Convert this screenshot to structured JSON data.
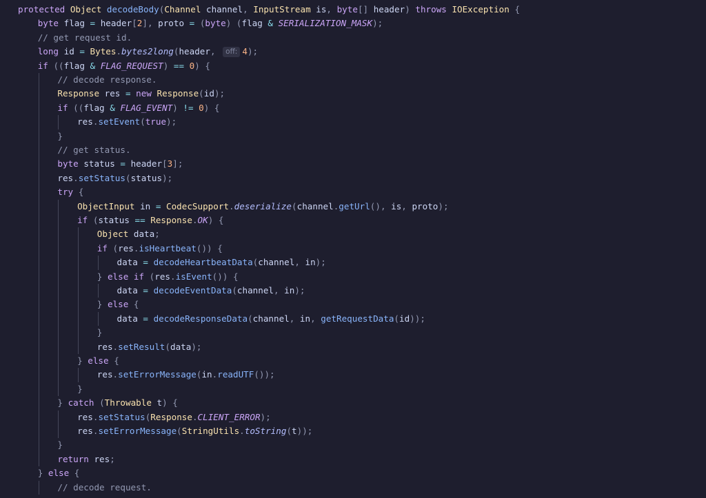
{
  "code": {
    "lines": [
      [
        [
          "kw",
          "protected "
        ],
        [
          "ty",
          "Object "
        ],
        [
          "fn",
          "decodeBody"
        ],
        [
          "pu",
          "("
        ],
        [
          "ty",
          "Channel "
        ],
        [
          "va",
          "channel"
        ],
        [
          "pu",
          ", "
        ],
        [
          "ty",
          "InputStream "
        ],
        [
          "va",
          "is"
        ],
        [
          "pu",
          ", "
        ],
        [
          "kw",
          "byte"
        ],
        [
          "pu",
          "[] "
        ],
        [
          "va",
          "header"
        ],
        [
          "pu",
          ") "
        ],
        [
          "kw",
          "throws "
        ],
        [
          "ty",
          "IOException "
        ],
        [
          "pu",
          "{"
        ]
      ],
      [
        [
          "kw",
          "byte "
        ],
        [
          "va",
          "flag "
        ],
        [
          "op",
          "= "
        ],
        [
          "va",
          "header"
        ],
        [
          "pu",
          "["
        ],
        [
          "nu",
          "2"
        ],
        [
          "pu",
          "], "
        ],
        [
          "va",
          "proto "
        ],
        [
          "op",
          "= "
        ],
        [
          "pu",
          "("
        ],
        [
          "kw",
          "byte"
        ],
        [
          "pu",
          ") ("
        ],
        [
          "va",
          "flag "
        ],
        [
          "op",
          "& "
        ],
        [
          "co",
          "SERIALIZATION_MASK"
        ],
        [
          "pu",
          ");"
        ]
      ],
      [
        [
          "cm",
          "// get request id."
        ]
      ],
      [
        [
          "kw",
          "long "
        ],
        [
          "va",
          "id "
        ],
        [
          "op",
          "= "
        ],
        [
          "ty",
          "Bytes"
        ],
        [
          "pu",
          "."
        ],
        [
          "it",
          "bytes2long"
        ],
        [
          "pu",
          "("
        ],
        [
          "va",
          "header"
        ],
        [
          "pu",
          ", "
        ],
        [
          "hint",
          "off:"
        ],
        [
          "nu",
          "4"
        ],
        [
          "pu",
          ");"
        ]
      ],
      [
        [
          "kw",
          "if "
        ],
        [
          "pu",
          "(("
        ],
        [
          "va",
          "flag "
        ],
        [
          "op",
          "& "
        ],
        [
          "co",
          "FLAG_REQUEST"
        ],
        [
          "pu",
          ") "
        ],
        [
          "op",
          "== "
        ],
        [
          "nu",
          "0"
        ],
        [
          "pu",
          ") {"
        ]
      ],
      [
        [
          "cm",
          "// decode response."
        ]
      ],
      [
        [
          "ty",
          "Response "
        ],
        [
          "va",
          "res "
        ],
        [
          "op",
          "= "
        ],
        [
          "kw",
          "new "
        ],
        [
          "ty",
          "Response"
        ],
        [
          "pu",
          "("
        ],
        [
          "va",
          "id"
        ],
        [
          "pu",
          ");"
        ]
      ],
      [
        [
          "kw",
          "if "
        ],
        [
          "pu",
          "(("
        ],
        [
          "va",
          "flag "
        ],
        [
          "op",
          "& "
        ],
        [
          "co",
          "FLAG_EVENT"
        ],
        [
          "pu",
          ") "
        ],
        [
          "op",
          "!= "
        ],
        [
          "nu",
          "0"
        ],
        [
          "pu",
          ") {"
        ]
      ],
      [
        [
          "va",
          "res"
        ],
        [
          "pu",
          "."
        ],
        [
          "fn",
          "setEvent"
        ],
        [
          "pu",
          "("
        ],
        [
          "kw",
          "true"
        ],
        [
          "pu",
          ");"
        ]
      ],
      [
        [
          "pu",
          "}"
        ]
      ],
      [
        [
          "cm",
          "// get status."
        ]
      ],
      [
        [
          "kw",
          "byte "
        ],
        [
          "va",
          "status "
        ],
        [
          "op",
          "= "
        ],
        [
          "va",
          "header"
        ],
        [
          "pu",
          "["
        ],
        [
          "nu",
          "3"
        ],
        [
          "pu",
          "];"
        ]
      ],
      [
        [
          "va",
          "res"
        ],
        [
          "pu",
          "."
        ],
        [
          "fn",
          "setStatus"
        ],
        [
          "pu",
          "("
        ],
        [
          "va",
          "status"
        ],
        [
          "pu",
          ");"
        ]
      ],
      [
        [
          "kw",
          "try "
        ],
        [
          "pu",
          "{"
        ]
      ],
      [
        [
          "ty",
          "ObjectInput "
        ],
        [
          "va",
          "in "
        ],
        [
          "op",
          "= "
        ],
        [
          "ty",
          "CodecSupport"
        ],
        [
          "pu",
          "."
        ],
        [
          "it",
          "deserialize"
        ],
        [
          "pu",
          "("
        ],
        [
          "va",
          "channel"
        ],
        [
          "pu",
          "."
        ],
        [
          "fn",
          "getUrl"
        ],
        [
          "pu",
          "(), "
        ],
        [
          "va",
          "is"
        ],
        [
          "pu",
          ", "
        ],
        [
          "va",
          "proto"
        ],
        [
          "pu",
          ");"
        ]
      ],
      [
        [
          "kw",
          "if "
        ],
        [
          "pu",
          "("
        ],
        [
          "va",
          "status "
        ],
        [
          "op",
          "== "
        ],
        [
          "ty",
          "Response"
        ],
        [
          "pu",
          "."
        ],
        [
          "co",
          "OK"
        ],
        [
          "pu",
          ") {"
        ]
      ],
      [
        [
          "ty",
          "Object "
        ],
        [
          "va",
          "data"
        ],
        [
          "pu",
          ";"
        ]
      ],
      [
        [
          "kw",
          "if "
        ],
        [
          "pu",
          "("
        ],
        [
          "va",
          "res"
        ],
        [
          "pu",
          "."
        ],
        [
          "fn",
          "isHeartbeat"
        ],
        [
          "pu",
          "()) {"
        ]
      ],
      [
        [
          "va",
          "data "
        ],
        [
          "op",
          "= "
        ],
        [
          "fn",
          "decodeHeartbeatData"
        ],
        [
          "pu",
          "("
        ],
        [
          "va",
          "channel"
        ],
        [
          "pu",
          ", "
        ],
        [
          "va",
          "in"
        ],
        [
          "pu",
          ");"
        ]
      ],
      [
        [
          "pu",
          "} "
        ],
        [
          "kw",
          "else if "
        ],
        [
          "pu",
          "("
        ],
        [
          "va",
          "res"
        ],
        [
          "pu",
          "."
        ],
        [
          "fn",
          "isEvent"
        ],
        [
          "pu",
          "()) {"
        ]
      ],
      [
        [
          "va",
          "data "
        ],
        [
          "op",
          "= "
        ],
        [
          "fn",
          "decodeEventData"
        ],
        [
          "pu",
          "("
        ],
        [
          "va",
          "channel"
        ],
        [
          "pu",
          ", "
        ],
        [
          "va",
          "in"
        ],
        [
          "pu",
          ");"
        ]
      ],
      [
        [
          "pu",
          "} "
        ],
        [
          "kw",
          "else "
        ],
        [
          "pu",
          "{"
        ]
      ],
      [
        [
          "va",
          "data "
        ],
        [
          "op",
          "= "
        ],
        [
          "fn",
          "decodeResponseData"
        ],
        [
          "pu",
          "("
        ],
        [
          "va",
          "channel"
        ],
        [
          "pu",
          ", "
        ],
        [
          "va",
          "in"
        ],
        [
          "pu",
          ", "
        ],
        [
          "fn",
          "getRequestData"
        ],
        [
          "pu",
          "("
        ],
        [
          "va",
          "id"
        ],
        [
          "pu",
          "));"
        ]
      ],
      [
        [
          "pu",
          "}"
        ]
      ],
      [
        [
          "va",
          "res"
        ],
        [
          "pu",
          "."
        ],
        [
          "fn",
          "setResult"
        ],
        [
          "pu",
          "("
        ],
        [
          "va",
          "data"
        ],
        [
          "pu",
          ");"
        ]
      ],
      [
        [
          "pu",
          "} "
        ],
        [
          "kw",
          "else "
        ],
        [
          "pu",
          "{"
        ]
      ],
      [
        [
          "va",
          "res"
        ],
        [
          "pu",
          "."
        ],
        [
          "fn",
          "setErrorMessage"
        ],
        [
          "pu",
          "("
        ],
        [
          "va",
          "in"
        ],
        [
          "pu",
          "."
        ],
        [
          "fn",
          "readUTF"
        ],
        [
          "pu",
          "());"
        ]
      ],
      [
        [
          "pu",
          "}"
        ]
      ],
      [
        [
          "pu",
          "} "
        ],
        [
          "kw",
          "catch "
        ],
        [
          "pu",
          "("
        ],
        [
          "ty",
          "Throwable "
        ],
        [
          "va",
          "t"
        ],
        [
          "pu",
          ") {"
        ]
      ],
      [
        [
          "va",
          "res"
        ],
        [
          "pu",
          "."
        ],
        [
          "fn",
          "setStatus"
        ],
        [
          "pu",
          "("
        ],
        [
          "ty",
          "Response"
        ],
        [
          "pu",
          "."
        ],
        [
          "co",
          "CLIENT_ERROR"
        ],
        [
          "pu",
          ");"
        ]
      ],
      [
        [
          "va",
          "res"
        ],
        [
          "pu",
          "."
        ],
        [
          "fn",
          "setErrorMessage"
        ],
        [
          "pu",
          "("
        ],
        [
          "ty",
          "StringUtils"
        ],
        [
          "pu",
          "."
        ],
        [
          "it",
          "toString"
        ],
        [
          "pu",
          "("
        ],
        [
          "va",
          "t"
        ],
        [
          "pu",
          "));"
        ]
      ],
      [
        [
          "pu",
          "}"
        ]
      ],
      [
        [
          "kw",
          "return "
        ],
        [
          "va",
          "res"
        ],
        [
          "pu",
          ";"
        ]
      ],
      [
        [
          "pu",
          "} "
        ],
        [
          "kw",
          "else "
        ],
        [
          "pu",
          "{"
        ]
      ],
      [
        [
          "cm",
          "// decode request."
        ]
      ]
    ]
  }
}
